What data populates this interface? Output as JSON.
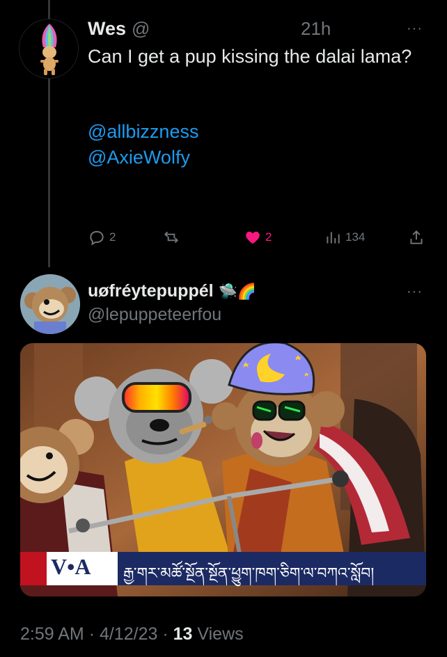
{
  "tweet1": {
    "name": "Wes",
    "handle": "@",
    "time": "21h",
    "text": "Can I get a pup kissing the dalai lama?",
    "mentions": [
      "@allbizzness",
      "@AxieWolfy"
    ],
    "actions": {
      "replies": "2",
      "likes": "2",
      "views": "134"
    }
  },
  "tweet2": {
    "name": "uøfréytepuppél",
    "name_emoji": "🛸🌈",
    "handle": "@lepuppeteerfou",
    "media": {
      "banner_logo": "V•A",
      "banner_text": "རྒྱ་གར་མཚོ་སྔོན་སྔོན་ཕྱུག་ཁག་ཅིག་ལ་བཀའ་སློབ།"
    },
    "footer": {
      "time": "2:59 AM",
      "date": "4/12/23",
      "views_count": "13",
      "views_label": "Views"
    }
  },
  "icons": [
    "reply-icon",
    "retweet-icon",
    "heart-icon",
    "views-icon",
    "share-icon",
    "more-icon"
  ],
  "colors": {
    "like": "#f91880",
    "link": "#1d9bf0",
    "muted": "#71767b"
  }
}
